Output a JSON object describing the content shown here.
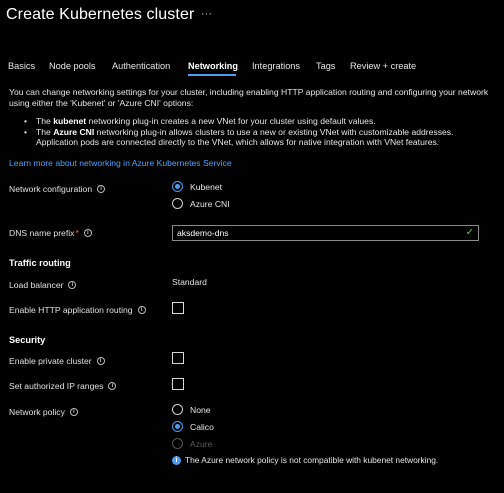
{
  "header": {
    "title": "Create Kubernetes cluster",
    "more": "···"
  },
  "tabs": [
    {
      "label": "Basics"
    },
    {
      "label": "Node pools"
    },
    {
      "label": "Authentication"
    },
    {
      "label": "Networking"
    },
    {
      "label": "Integrations"
    },
    {
      "label": "Tags"
    },
    {
      "label": "Review + create"
    }
  ],
  "intro": {
    "text": "You can change networking settings for your cluster, including enabling HTTP application routing and configuring your network using either the 'Kubenet' or 'Azure CNI' options:",
    "bullet1_pre": "The ",
    "bullet1_bold": "kubenet",
    "bullet1_post": " networking plug-in creates a new VNet for your cluster using default values.",
    "bullet2_pre": "The ",
    "bullet2_bold": "Azure CNI",
    "bullet2_post": " networking plug-in allows clusters to use a new or existing VNet with customizable addresses. Application pods are connected directly to the VNet, which allows for native integration with VNet features.",
    "link": "Learn more about networking in Azure Kubernetes Service"
  },
  "network_config": {
    "label": "Network configuration",
    "options": [
      "Kubenet",
      "Azure CNI"
    ]
  },
  "dns": {
    "label": "DNS name prefix",
    "required": "*",
    "value": "aksdemo-dns",
    "valid_icon": "✓"
  },
  "traffic": {
    "heading": "Traffic routing",
    "load_balancer_label": "Load balancer",
    "load_balancer_value": "Standard",
    "http_routing_label": "Enable HTTP application routing"
  },
  "security": {
    "heading": "Security",
    "private_cluster_label": "Enable private cluster",
    "authorized_ip_label": "Set authorized IP ranges",
    "network_policy_label": "Network policy",
    "policy_options": [
      "None",
      "Calico",
      "Azure"
    ],
    "policy_note": "The Azure network policy is not compatible with kubenet networking."
  },
  "colors": {
    "accent": "#4c9df0",
    "link": "#4da3ff",
    "valid": "#5ec75e"
  }
}
